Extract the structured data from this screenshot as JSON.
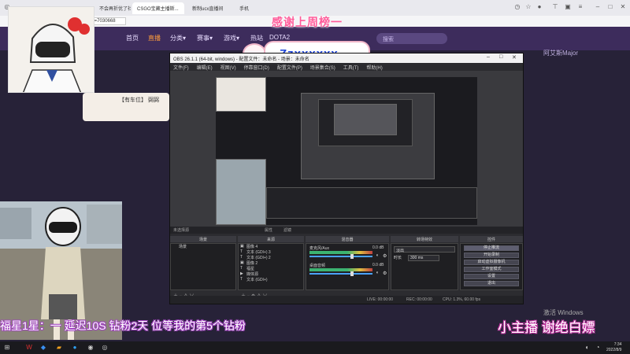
{
  "browser": {
    "tabs": [
      "不会再折优了社直播间",
      "CSGO宝藏主播斯...",
      "新制ucx直播间",
      "手机"
    ],
    "address": "nd=7030668"
  },
  "site": {
    "nav": [
      "首页",
      "直播",
      "分类▾",
      "赛事▾",
      "游戏▾",
      "热站",
      "DOTA2"
    ],
    "search_placeholder": "搜索",
    "promo_right": "阿艾斯Major",
    "promo_left": "【有车位】 弼弼"
  },
  "overlay": {
    "thanks": "感谢上周榜一",
    "top_name": "Zzxxxxxx",
    "left_caption": "福星1星：一 延迟10S  钻粉2天  位等我的第5个钻粉",
    "right_caption": "小主播 谢绝白嫖",
    "windows_watermark": "激活 Windows"
  },
  "obs": {
    "title": "OBS 26.1.1 (64-bit, windows) - 配置文件：未命名 - 场景：未命名",
    "menu": [
      "文件(F)",
      "编辑(E)",
      "视图(V)",
      "停靠窗口(D)",
      "配置文件(P)",
      "场景集合(S)",
      "工具(T)",
      "帮助(H)"
    ],
    "dock_tabs": [
      "未选择源",
      "属性",
      "滤镜"
    ],
    "panels": {
      "scenes": "场景",
      "sources": "来源",
      "mixer": "混音器",
      "transitions": "转场特效",
      "controls": "控件"
    },
    "scene_item": "场景",
    "sources": [
      {
        "icon": "image",
        "label": "图像 4"
      },
      {
        "icon": "text",
        "label": "文本 (GDI+) 3"
      },
      {
        "icon": "text",
        "label": "文本 (GDI+) 2"
      },
      {
        "icon": "image",
        "label": "图像 2"
      },
      {
        "icon": "text",
        "label": "福星"
      },
      {
        "icon": "media",
        "label": "媒体源"
      },
      {
        "icon": "text",
        "label": "文本 (GDI+)"
      }
    ],
    "mixer": [
      {
        "name": "麦克风/Aux",
        "db": "0.0 dB"
      },
      {
        "name": "桌面音频",
        "db": "0.0 dB"
      }
    ],
    "transition": {
      "type": "淡出",
      "duration_label": "时长",
      "duration": "300 ms"
    },
    "controls": [
      "停止推流",
      "开始录制",
      "启动虚拟摄像机",
      "工作室模式",
      "设置",
      "退出"
    ],
    "status": {
      "live": "LIVE: 00:00:00",
      "rec": "REC: 00:00:00",
      "cpu": "CPU: 1.3%, 60.00 fps"
    }
  },
  "taskbar": {
    "time": "7:34",
    "date": "2022/8/9"
  }
}
